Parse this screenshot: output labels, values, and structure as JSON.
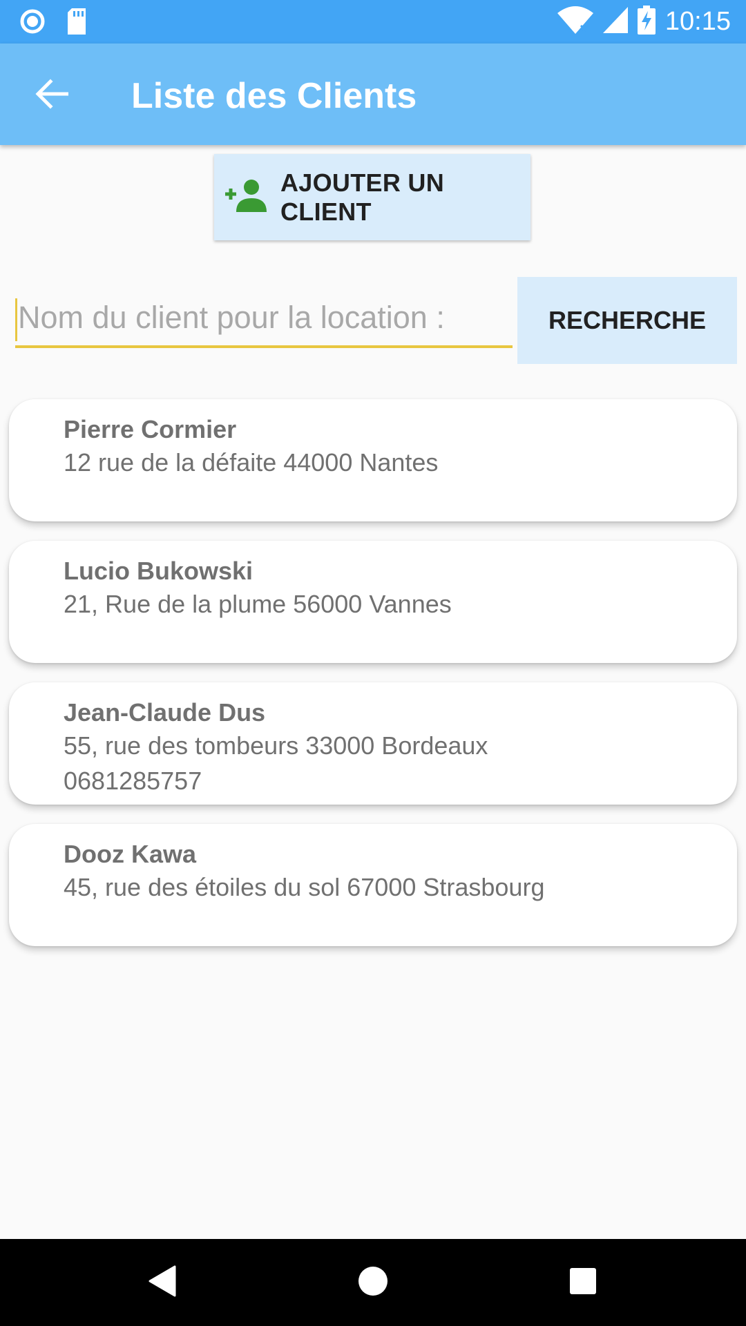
{
  "status_bar": {
    "time": "10:15",
    "icons": [
      "record-icon",
      "sd-card-icon",
      "wifi-icon",
      "signal-icon",
      "battery-charging-icon"
    ]
  },
  "app_bar": {
    "title": "Liste des Clients",
    "back_icon": "arrow-back-icon"
  },
  "add_client": {
    "label": "AJOUTER UN CLIENT",
    "icon": "person-add-icon",
    "icon_color": "#3a9a33"
  },
  "search": {
    "placeholder": "Nom du client pour la location :",
    "value": "",
    "button_label": "RECHERCHE",
    "underline_color": "#e8c640"
  },
  "clients": [
    {
      "name": "Pierre Cormier",
      "address": "12 rue de la défaite 44000 Nantes",
      "phone": ""
    },
    {
      "name": "Lucio Bukowski",
      "address": "21, Rue de la plume 56000 Vannes",
      "phone": ""
    },
    {
      "name": "Jean-Claude Dus",
      "address": "55, rue des tombeurs 33000 Bordeaux",
      "phone": "0681285757"
    },
    {
      "name": "Dooz Kawa",
      "address": "45, rue des étoiles du sol 67000 Strasbourg",
      "phone": ""
    }
  ],
  "nav_bar": {
    "icons": [
      "back-triangle-icon",
      "home-circle-icon",
      "recents-square-icon"
    ]
  },
  "colors": {
    "status_bar": "#42a5f5",
    "app_bar": "#6ebef7",
    "button_bg": "#d9ecfb"
  }
}
